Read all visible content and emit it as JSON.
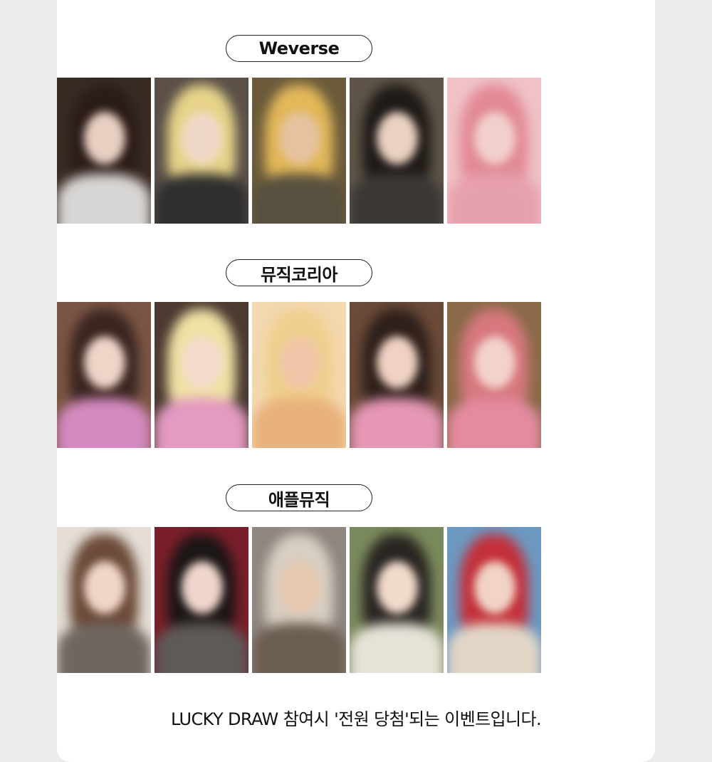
{
  "sections": [
    {
      "title": "Weverse",
      "photos": [
        {
          "bg": "#3a2a24",
          "hair": "#2b1c17",
          "face": "#e8cfc2",
          "body": "#d8d6d4",
          "alt": "member-1"
        },
        {
          "bg": "#5a5048",
          "hair": "#e7d48a",
          "face": "#f0d8c8",
          "body": "#2f2f2f",
          "alt": "member-2"
        },
        {
          "bg": "#6b5b3a",
          "hair": "#e2b859",
          "face": "#e6c2a0",
          "body": "#58503f",
          "alt": "member-3"
        },
        {
          "bg": "#5e5548",
          "hair": "#1f1a18",
          "face": "#ead1c0",
          "body": "#3b3836",
          "alt": "member-4"
        },
        {
          "bg": "#f0c2c8",
          "hair": "#e28a95",
          "face": "#f1d0cb",
          "body": "#e7a0ae",
          "alt": "member-5"
        }
      ]
    },
    {
      "title": "뮤직코리아",
      "photos": [
        {
          "bg": "#7a5544",
          "hair": "#3a2520",
          "face": "#efd4c8",
          "body": "#d48ac0",
          "alt": "member-1"
        },
        {
          "bg": "#4a3a30",
          "hair": "#efe2a5",
          "face": "#f3dacb",
          "body": "#e49ac2",
          "alt": "member-2"
        },
        {
          "bg": "#f3d8b0",
          "hair": "#f0cf8e",
          "face": "#efc6a8",
          "body": "#e8b07a",
          "alt": "member-3"
        },
        {
          "bg": "#6a4a38",
          "hair": "#2e201a",
          "face": "#f0d2c4",
          "body": "#e597b5",
          "alt": "member-4"
        },
        {
          "bg": "#8b6a4a",
          "hair": "#d7787e",
          "face": "#f2d3cb",
          "body": "#e48ba1",
          "alt": "member-5"
        }
      ]
    },
    {
      "title": "애플뮤직",
      "photos": [
        {
          "bg": "#e4ded6",
          "hair": "#6b4a38",
          "face": "#f0d6c8",
          "body": "#6e6660",
          "alt": "member-1"
        },
        {
          "bg": "#7a1f2a",
          "hair": "#1c1616",
          "face": "#f0d6cc",
          "body": "#5e5a58",
          "alt": "member-2"
        },
        {
          "bg": "#8f8680",
          "hair": "#d8cfc2",
          "face": "#e6c8b0",
          "body": "#6b5d50",
          "alt": "member-3"
        },
        {
          "bg": "#7a8a5c",
          "hair": "#2a2522",
          "face": "#f1dacb",
          "body": "#e7e2d8",
          "alt": "member-4"
        },
        {
          "bg": "#6d98c0",
          "hair": "#c4303a",
          "face": "#f1d4c6",
          "body": "#e2d6c6",
          "alt": "member-5"
        }
      ]
    }
  ],
  "footer_text": "LUCKY DRAW 참여시 '전원 당첨'되는 이벤트입니다."
}
